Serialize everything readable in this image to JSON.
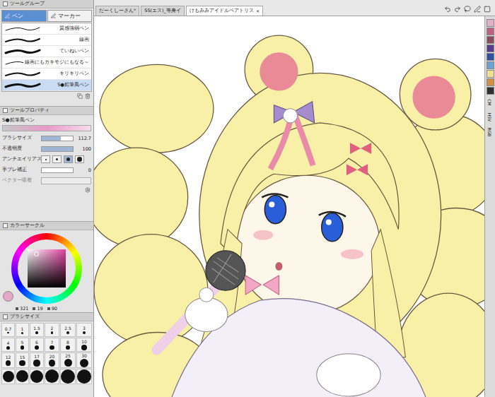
{
  "tool_group": {
    "title": "ツールグループ",
    "tabs": [
      {
        "label": "ペン",
        "selected": true
      },
      {
        "label": "マーカー",
        "selected": false
      }
    ],
    "brushes": [
      {
        "name": "質感強弱ペン",
        "selected": false
      },
      {
        "name": "線画",
        "selected": false
      },
      {
        "name": "ていねいペン",
        "selected": false
      },
      {
        "name": "線画にもカキモジにもなる～",
        "selected": false
      },
      {
        "name": "キリキリペン",
        "selected": false
      },
      {
        "name": "S●鉛筆風ペン",
        "selected": true
      }
    ]
  },
  "tool_property": {
    "title": "ツールプロパティ",
    "tool_name": "S●鉛筆風ペン",
    "rows": [
      {
        "kind": "slider",
        "label": "ブラシサイズ",
        "value": "112.7",
        "level": 0.62,
        "disabled": false
      },
      {
        "kind": "slider",
        "label": "不透明度",
        "value": "100",
        "level": 1,
        "disabled": false
      },
      {
        "kind": "options",
        "label": "アンチエイリアス",
        "options": [
          {
            "selected": false
          },
          {
            "selected": false
          },
          {
            "selected": true
          },
          {
            "selected": false
          }
        ],
        "disabled": false
      },
      {
        "kind": "slider",
        "label": "手ブレ補正",
        "value": "0",
        "level": 0,
        "disabled": false
      },
      {
        "kind": "toggle",
        "label": "ベクター吸着",
        "disabled": true
      }
    ]
  },
  "color_circle": {
    "title": "カラーサークル",
    "values": [
      "321",
      "19",
      "90"
    ],
    "current_color": "#e6a8c9"
  },
  "brush_size": {
    "title": "ブラシサイズ",
    "sizes": [
      "0.7",
      "1",
      "1.5",
      "2",
      "2.5",
      "3",
      "4",
      "5",
      "6",
      "7",
      "8",
      "10",
      "12",
      "15",
      "17",
      "20",
      "25",
      "30"
    ]
  },
  "documents": [
    {
      "title": "だーくしーさん*",
      "selected": false
    },
    {
      "title": "SS(エス)_等身イ",
      "selected": false
    },
    {
      "title": "けもみみアイドルベアトリス",
      "selected": true
    }
  ],
  "close": "×",
  "side_tabs": [
    "CM",
    "HSV",
    "RGB"
  ],
  "palette": [
    {
      "color": "#e0b0c8"
    },
    {
      "color": "#c06080"
    },
    {
      "color": "#8c4a5e"
    },
    {
      "color": "#5a3a8a"
    },
    {
      "color": "#3050a0"
    },
    {
      "color": "#70a0d0"
    },
    {
      "color": "#f0e090"
    },
    {
      "color": "#d09040"
    },
    {
      "color": "#303030"
    }
  ]
}
